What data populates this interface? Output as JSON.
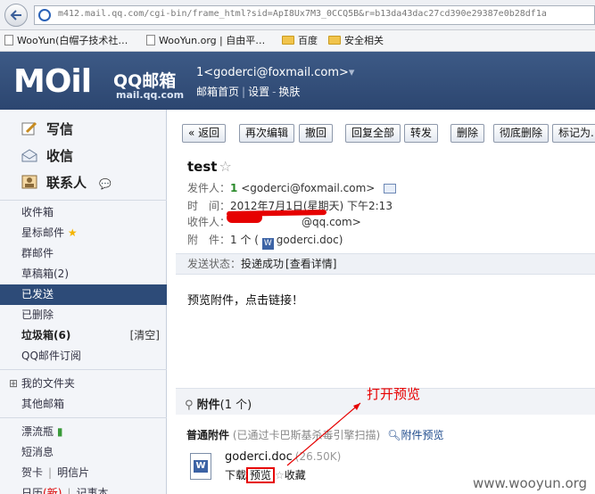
{
  "browser": {
    "url": "m412.mail.qq.com/cgi-bin/frame_html?sid=ApI8Ux7M3_0CCQ5B&r=b13da43dac27cd390e29387e0b28df1a",
    "bookmarks": [
      "WooYun(白帽子技术社…",
      "WooYun.org",
      "| 自由平…",
      "百度",
      "安全相关"
    ]
  },
  "header": {
    "logo": "MOil",
    "logo_cn": "QQ邮箱",
    "logo_url": "mail.qq.com",
    "account": "1<goderci@foxmail.com>",
    "account_caret": "▾",
    "links": [
      "邮箱首页",
      "设置",
      "换肤"
    ]
  },
  "sidebar": {
    "write": "写信",
    "inbox": "收信",
    "contacts": "联系人",
    "folders": [
      {
        "label": "收件箱"
      },
      {
        "label": "星标邮件"
      },
      {
        "label": "群邮件"
      },
      {
        "label": "草稿箱(2)"
      },
      {
        "label": "已发送"
      },
      {
        "label": "已删除"
      },
      {
        "label": "垃圾箱(6)",
        "right": "[清空]"
      },
      {
        "label": "QQ邮件订阅"
      }
    ],
    "myfolders": "我的文件夹",
    "other_mail": "其他邮箱",
    "drift_bottle": "漂流瓶",
    "short_msg": "短消息",
    "card": "贺卡",
    "postcard": "明信片",
    "calendar": "日历",
    "calendar_new": "(新)",
    "notebook": "记事本",
    "toggle": "⊞"
  },
  "toolbar": [
    "« 返回",
    "再次编辑",
    "撤回",
    "回复全部",
    "转发",
    "删除",
    "彻底删除",
    "标记为..."
  ],
  "mail": {
    "subject": "test",
    "from_label": "发件人：",
    "from_num": "1",
    "from_addr": "<goderci@foxmail.com>",
    "time_label": "时　间：",
    "time_value": "2012年7月1日(星期天) 下午2:13",
    "to_label": "收件人：",
    "to_value": "@qq.com>",
    "attach_label": "附　件：",
    "attach_value": "1 个 (",
    "attach_file": "goderci.doc",
    "attach_close": ")",
    "status_label": "发送状态：",
    "status_value": "投递成功",
    "status_link": "[查看详情]",
    "body": "预览附件，点击链接！"
  },
  "attachments": {
    "title": "附件",
    "count": "(1 个)",
    "section": "普通附件",
    "scan_note": "(已通过卡巴斯基杀毒引擎扫描)",
    "preview_all": "附件预览",
    "file_name": "goderci.doc",
    "file_size": "(26.50K)",
    "download": "下载",
    "preview": "预览",
    "collect": "收藏"
  },
  "annotation": "打开预览",
  "watermark": "www.wooyun.org",
  "colors": {
    "header_bg": "#2c4670",
    "active_folder": "#2d4b78",
    "annotation_red": "#e60000"
  }
}
